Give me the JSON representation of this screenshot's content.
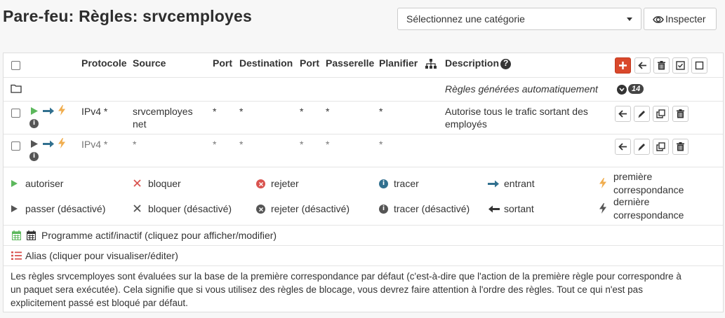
{
  "header": {
    "title": "Pare-feu: Règles: srvcemployes",
    "category_select": "Sélectionnez une catégorie",
    "inspect_label": "Inspecter"
  },
  "table": {
    "columns": {
      "protocol": "Protocole",
      "source": "Source",
      "port_src": "Port",
      "destination": "Destination",
      "port_dst": "Port",
      "gateway": "Passerelle",
      "schedule": "Planifier",
      "description": "Description"
    },
    "auto_group": {
      "label": "Règles générées automatiquement",
      "count": "14"
    },
    "rows": [
      {
        "protocol": "IPv4 *",
        "source_line1": "srvcemployes",
        "source_line2": "net",
        "port_src": "*",
        "destination": "*",
        "port_dst": "*",
        "gateway": "*",
        "schedule": "*",
        "desc_line1": "Autorise tous le trafic sortant des",
        "desc_line2": "employés",
        "enabled": true
      },
      {
        "protocol": "IPv4 *",
        "source_line1": "*",
        "source_line2": "",
        "port_src": "*",
        "destination": "*",
        "port_dst": "*",
        "gateway": "*",
        "schedule": "*",
        "desc_line1": "",
        "desc_line2": "",
        "enabled": false
      }
    ]
  },
  "legend": {
    "pass": "autoriser",
    "block": "bloquer",
    "reject": "rejeter",
    "log": "tracer",
    "in": "entrant",
    "first_match_l1": "première",
    "first_match_l2": "correspondance",
    "pass_disabled": "passer (désactivé)",
    "block_disabled": "bloquer (désactivé)",
    "reject_disabled": "rejeter (désactivé)",
    "log_disabled": "tracer (désactivé)",
    "out": "sortant",
    "last_match_l1": "dernière",
    "last_match_l2": "correspondance"
  },
  "schedule_note": "Programme actif/inactif (cliquez pour afficher/modifier)",
  "alias_note": "Alias (cliquer pour visualiser/éditer)",
  "footer_note_l1": "Les règles srvcemployes sont évaluées sur la base de la première correspondance par défaut (c'est-à-dire que l'action de la première règle pour correspondre à",
  "footer_note_l2": "un paquet sera exécutée). Cela signifie que si vous utilisez des règles de blocage, vous devrez faire attention à l'ordre des règles. Tout ce qui n'est pas",
  "footer_note_l3": "explicitement passé est bloqué par défaut.",
  "colors": {
    "accent_red": "#d9482b",
    "pass_green": "#5cb85c",
    "arrow_blue": "#31708f",
    "bolt_orange": "#f0ad4e",
    "reject_red": "#d9534f",
    "info_blue": "#31708f"
  }
}
